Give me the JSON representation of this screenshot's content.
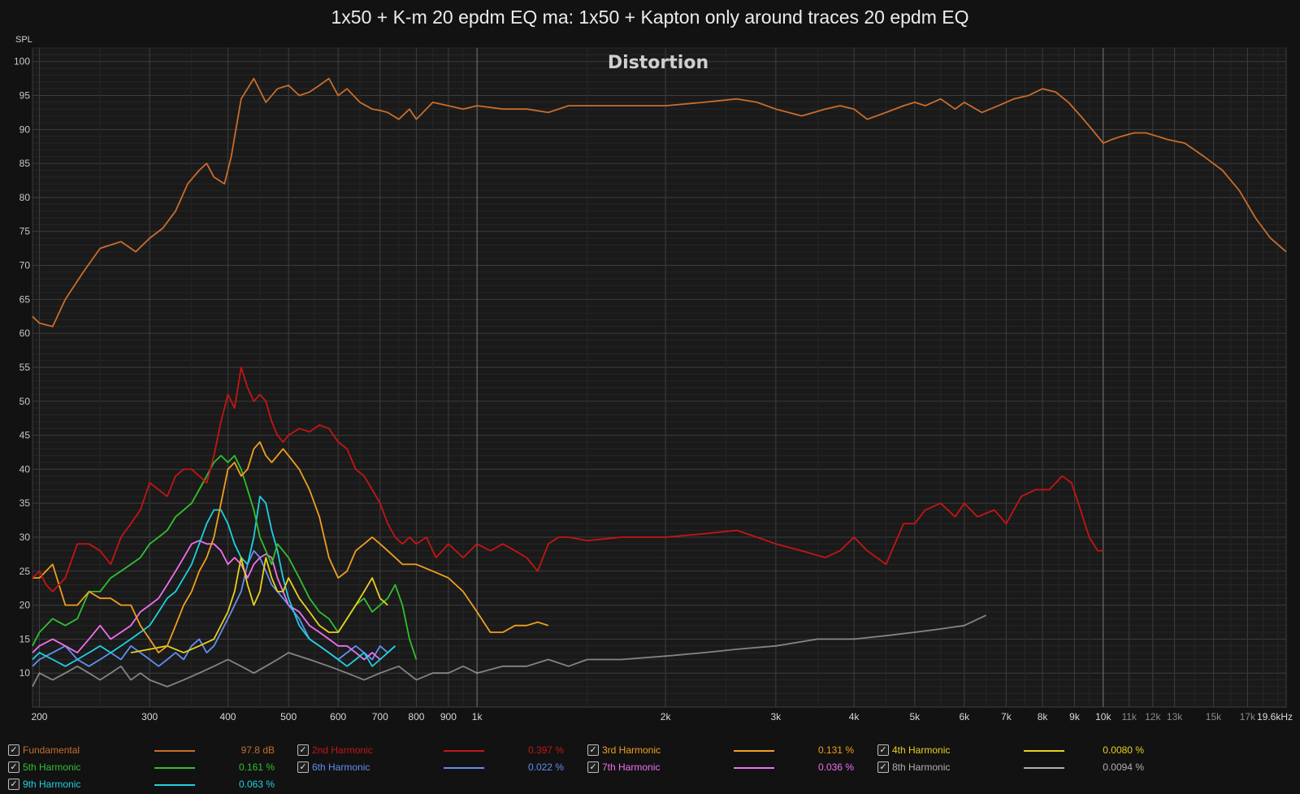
{
  "title": "1x50 + K-m 20 epdm EQ ma: 1x50 + Kapton only around traces 20 epdm EQ",
  "chart_data": {
    "type": "line",
    "title": "Distortion",
    "ylabel": "SPL",
    "x_scale": "log",
    "xlim": [
      195,
      19600
    ],
    "ylim": [
      5,
      102
    ],
    "y_ticks": [
      10,
      15,
      20,
      25,
      30,
      35,
      40,
      45,
      50,
      55,
      60,
      65,
      70,
      75,
      80,
      85,
      90,
      95,
      100
    ],
    "x_ticks": [
      {
        "v": 200,
        "label": "200"
      },
      {
        "v": 300,
        "label": "300"
      },
      {
        "v": 400,
        "label": "400"
      },
      {
        "v": 500,
        "label": "500"
      },
      {
        "v": 600,
        "label": "600"
      },
      {
        "v": 700,
        "label": "700"
      },
      {
        "v": 800,
        "label": "800"
      },
      {
        "v": 900,
        "label": "900"
      },
      {
        "v": 1000,
        "label": "1k"
      },
      {
        "v": 2000,
        "label": "2k"
      },
      {
        "v": 3000,
        "label": "3k"
      },
      {
        "v": 4000,
        "label": "4k"
      },
      {
        "v": 5000,
        "label": "5k"
      },
      {
        "v": 6000,
        "label": "6k"
      },
      {
        "v": 7000,
        "label": "7k"
      },
      {
        "v": 8000,
        "label": "8k"
      },
      {
        "v": 9000,
        "label": "9k"
      },
      {
        "v": 10000,
        "label": "10k"
      },
      {
        "v": 11000,
        "label": "11k"
      },
      {
        "v": 12000,
        "label": "12k"
      },
      {
        "v": 13000,
        "label": "13k"
      },
      {
        "v": 15000,
        "label": "15k"
      },
      {
        "v": 17000,
        "label": "17k"
      },
      {
        "v": 19600,
        "label": "19.6kHz"
      }
    ],
    "series": [
      {
        "name": "Fundamental",
        "color": "#c86d2d",
        "value": "97.8 dB",
        "x": [
          195,
          200,
          210,
          220,
          235,
          250,
          270,
          285,
          300,
          315,
          330,
          345,
          360,
          370,
          380,
          395,
          405,
          420,
          440,
          460,
          480,
          500,
          520,
          540,
          560,
          580,
          600,
          620,
          650,
          680,
          700,
          720,
          750,
          780,
          800,
          850,
          900,
          950,
          1000,
          1100,
          1200,
          1300,
          1400,
          1500,
          1700,
          2000,
          2300,
          2600,
          2800,
          3000,
          3300,
          3600,
          3800,
          4000,
          4200,
          4500,
          4800,
          5000,
          5200,
          5500,
          5800,
          6000,
          6400,
          6800,
          7200,
          7600,
          8000,
          8400,
          8800,
          9200,
          9600,
          10000,
          10300,
          10700,
          11200,
          11700,
          12200,
          12700,
          13500,
          14500,
          15500,
          16500,
          17500,
          18500,
          19600
        ],
        "y": [
          62.5,
          61.5,
          61,
          65,
          69,
          72.5,
          73.5,
          72,
          74,
          75.5,
          78,
          82,
          84,
          85,
          83,
          82,
          86,
          94.5,
          97.5,
          94,
          96,
          96.5,
          95,
          95.5,
          96.5,
          97.5,
          95,
          96,
          94,
          93,
          92.8,
          92.5,
          91.5,
          93,
          91.5,
          94,
          93.5,
          93,
          93.5,
          93,
          93,
          92.5,
          93.5,
          93.5,
          93.5,
          93.5,
          94,
          94.5,
          94,
          93,
          92,
          93,
          93.5,
          93,
          91.5,
          92.5,
          93.5,
          94,
          93.5,
          94.5,
          93,
          94,
          92.5,
          93.5,
          94.5,
          95,
          96,
          95.5,
          94,
          92,
          90,
          88,
          88.5,
          89,
          89.5,
          89.5,
          89,
          88.5,
          88,
          86,
          84,
          81,
          77,
          74,
          72
        ]
      },
      {
        "name": "2nd Harmonic",
        "color": "#c41515",
        "value": "0.397 %",
        "x": [
          195,
          200,
          205,
          210,
          220,
          230,
          240,
          250,
          260,
          270,
          280,
          290,
          300,
          310,
          320,
          330,
          340,
          350,
          360,
          370,
          380,
          390,
          400,
          410,
          420,
          430,
          440,
          450,
          460,
          470,
          480,
          490,
          500,
          520,
          540,
          560,
          580,
          600,
          620,
          640,
          660,
          680,
          700,
          720,
          740,
          760,
          780,
          800,
          830,
          860,
          900,
          950,
          1000,
          1050,
          1100,
          1150,
          1200,
          1250,
          1300,
          1350,
          1400,
          1500,
          1700,
          2000,
          2300,
          2600,
          2800,
          3000,
          3300,
          3600,
          3800,
          4000,
          4200,
          4500,
          4800,
          5000,
          5200,
          5500,
          5800,
          6000,
          6300,
          6700,
          7000,
          7400,
          7800,
          8200,
          8600,
          8900,
          9200,
          9500,
          9800,
          10000
        ],
        "y": [
          24,
          25,
          23,
          22,
          24,
          29,
          29,
          28,
          26,
          30,
          32,
          34,
          38,
          37,
          36,
          39,
          40,
          40,
          39,
          38,
          42,
          47,
          51,
          49,
          55,
          52,
          50,
          51,
          50,
          47,
          45,
          44,
          45,
          46,
          45.5,
          46.5,
          46,
          44,
          43,
          40,
          39,
          37,
          35,
          32,
          30,
          29,
          30,
          29,
          30,
          27,
          29,
          27,
          29,
          28,
          29,
          28,
          27,
          25,
          29,
          30,
          30,
          29.5,
          30,
          30,
          30.5,
          31,
          30,
          29,
          28,
          27,
          28,
          30,
          28,
          26,
          32,
          32,
          34,
          35,
          33,
          35,
          33,
          34,
          32,
          36,
          37,
          37,
          39,
          38,
          34,
          30,
          28,
          28
        ]
      },
      {
        "name": "3rd Harmonic",
        "color": "#f0a020",
        "value": "0.131 %",
        "x": [
          195,
          200,
          210,
          220,
          230,
          240,
          250,
          260,
          270,
          280,
          290,
          300,
          310,
          320,
          330,
          340,
          350,
          360,
          370,
          380,
          390,
          400,
          410,
          420,
          430,
          440,
          450,
          460,
          470,
          480,
          490,
          500,
          520,
          540,
          560,
          580,
          600,
          620,
          640,
          660,
          680,
          700,
          720,
          740,
          760,
          780,
          800,
          850,
          900,
          950,
          1000,
          1050,
          1100,
          1150,
          1200,
          1250,
          1300
        ],
        "y": [
          24,
          24,
          26,
          20,
          20,
          22,
          21,
          21,
          20,
          20,
          17,
          15,
          13,
          14,
          17,
          20,
          22,
          25,
          27,
          30,
          35,
          40,
          41,
          39,
          40,
          43,
          44,
          42,
          41,
          42,
          43,
          42,
          40,
          37,
          33,
          27,
          24,
          25,
          28,
          29,
          30,
          29,
          28,
          27,
          26,
          26,
          26,
          25,
          24,
          22,
          19,
          16,
          16,
          17,
          17,
          17.5,
          17
        ]
      },
      {
        "name": "4th Harmonic",
        "color": "#e8d020",
        "value": "0.0080 %",
        "x": [
          280,
          300,
          320,
          340,
          360,
          380,
          400,
          410,
          420,
          430,
          440,
          450,
          460,
          470,
          480,
          490,
          500,
          520,
          540,
          560,
          580,
          600,
          620,
          640,
          660,
          680,
          700,
          720
        ],
        "y": [
          13,
          13.5,
          14,
          13,
          14,
          15,
          19,
          22,
          27,
          23,
          20,
          22,
          27,
          24,
          22,
          22,
          24,
          21,
          19,
          17,
          16,
          16,
          18,
          20,
          22,
          24,
          21,
          20
        ]
      },
      {
        "name": "5th Harmonic",
        "color": "#30c030",
        "value": "0.161 %",
        "x": [
          195,
          200,
          210,
          220,
          230,
          240,
          250,
          260,
          270,
          280,
          290,
          300,
          310,
          320,
          330,
          340,
          350,
          360,
          370,
          380,
          390,
          400,
          410,
          420,
          430,
          440,
          450,
          460,
          470,
          480,
          490,
          500,
          520,
          540,
          560,
          580,
          600,
          620,
          640,
          660,
          680,
          700,
          720,
          740,
          760,
          780,
          800
        ],
        "y": [
          14,
          16,
          18,
          17,
          18,
          22,
          22,
          24,
          25,
          26,
          27,
          29,
          30,
          31,
          33,
          34,
          35,
          37,
          39,
          41,
          42,
          41,
          42,
          40,
          37,
          34,
          30,
          28,
          26,
          29,
          28,
          27,
          24,
          21,
          19,
          18,
          16,
          18,
          20,
          21,
          19,
          20,
          21,
          23,
          20,
          15,
          12
        ]
      },
      {
        "name": "6th Harmonic",
        "color": "#6090f0",
        "value": "0.022 %",
        "x": [
          195,
          200,
          210,
          220,
          230,
          240,
          250,
          260,
          270,
          280,
          290,
          300,
          310,
          320,
          330,
          340,
          350,
          360,
          370,
          380,
          390,
          400,
          410,
          420,
          430,
          440,
          450,
          460,
          470,
          480,
          490,
          500,
          520,
          540,
          560,
          580,
          600,
          620,
          640,
          660,
          680,
          700,
          720,
          740
        ],
        "y": [
          11,
          12,
          13,
          14,
          12,
          11,
          12,
          13,
          12,
          14,
          13,
          12,
          11,
          12,
          13,
          12,
          14,
          15,
          13,
          14,
          16,
          18,
          20,
          22,
          26,
          28,
          27,
          25,
          23,
          22,
          21,
          20,
          18,
          15,
          14,
          13,
          12,
          13,
          14,
          13,
          12,
          14,
          13,
          14
        ]
      },
      {
        "name": "7th Harmonic",
        "color": "#f070f0",
        "value": "0.036 %",
        "x": [
          195,
          200,
          210,
          220,
          230,
          240,
          250,
          260,
          270,
          280,
          290,
          300,
          310,
          320,
          330,
          340,
          350,
          360,
          370,
          380,
          390,
          400,
          410,
          420,
          430,
          440,
          450,
          460,
          470,
          480,
          490,
          500,
          520,
          540,
          560,
          580,
          600,
          620,
          640,
          660,
          680,
          700
        ],
        "y": [
          13,
          14,
          15,
          14,
          13,
          15,
          17,
          15,
          16,
          17,
          19,
          20,
          21,
          23,
          25,
          27,
          29,
          29.5,
          29,
          29,
          28,
          26,
          27,
          26,
          24,
          26,
          27,
          27.5,
          27,
          24,
          22,
          20,
          19,
          17,
          16,
          15,
          14,
          14,
          13,
          12,
          13,
          12
        ]
      },
      {
        "name": "8th Harmonic",
        "color": "#b0b0b0",
        "value": "0.0094 %",
        "x": [
          195,
          200,
          210,
          220,
          230,
          240,
          250,
          260,
          270,
          280,
          290,
          300,
          320,
          340,
          360,
          380,
          400,
          420,
          440,
          460,
          480,
          500,
          540,
          580,
          620,
          660,
          700,
          750,
          800,
          850,
          900,
          950,
          1000,
          1100,
          1200,
          1300,
          1400,
          1500,
          1700,
          2000,
          2300,
          2600,
          3000,
          3500,
          4000,
          4500,
          5000,
          5500,
          6000,
          6500
        ],
        "y": [
          8,
          10,
          9,
          10,
          11,
          10,
          9,
          10,
          11,
          9,
          10,
          9,
          8,
          9,
          10,
          11,
          12,
          11,
          10,
          11,
          12,
          13,
          12,
          11,
          10,
          9,
          10,
          11,
          9,
          10,
          10,
          11,
          10,
          11,
          11,
          12,
          11,
          12,
          12,
          12.5,
          13,
          13.5,
          14,
          15,
          15,
          15.5,
          16,
          16.5,
          17,
          18.5
        ]
      },
      {
        "name": "9th Harmonic",
        "color": "#20d0e0",
        "value": "0.063 %",
        "x": [
          195,
          200,
          210,
          220,
          230,
          240,
          250,
          260,
          270,
          280,
          290,
          300,
          310,
          320,
          330,
          340,
          350,
          360,
          370,
          380,
          390,
          400,
          410,
          420,
          430,
          440,
          450,
          460,
          470,
          480,
          490,
          500,
          520,
          540,
          560,
          580,
          600,
          620,
          640,
          660,
          680,
          700,
          720,
          740
        ],
        "y": [
          12,
          13,
          12,
          11,
          12,
          13,
          14,
          13,
          14,
          15,
          16,
          17,
          19,
          21,
          22,
          24,
          26,
          29,
          32,
          34,
          34,
          32,
          29,
          27,
          26,
          30,
          36,
          35,
          31,
          28,
          24,
          21,
          17,
          15,
          14,
          13,
          12,
          11,
          12,
          13,
          11,
          12,
          13,
          14
        ]
      }
    ]
  },
  "legend": [
    {
      "label": "Fundamental",
      "value": "97.8 dB",
      "color": "#c86d2d",
      "checked": "✓"
    },
    {
      "label": "2nd Harmonic",
      "value": "0.397 %",
      "color": "#c41515",
      "checked": "✓"
    },
    {
      "label": "3rd Harmonic",
      "value": "0.131 %",
      "color": "#f0a020",
      "checked": "✓"
    },
    {
      "label": "4th Harmonic",
      "value": "0.0080 %",
      "color": "#e8d020",
      "checked": "✓"
    },
    {
      "label": "5th Harmonic",
      "value": "0.161 %",
      "color": "#30c030",
      "checked": "✓"
    },
    {
      "label": "6th Harmonic",
      "value": "0.022 %",
      "color": "#6090f0",
      "checked": "✓"
    },
    {
      "label": "7th Harmonic",
      "value": "0.036 %",
      "color": "#f070f0",
      "checked": "✓"
    },
    {
      "label": "8th Harmonic",
      "value": "0.0094 %",
      "color": "#b0b0b0",
      "checked": "✓"
    },
    {
      "label": "9th Harmonic",
      "value": "0.063 %",
      "color": "#20d0e0",
      "checked": "✓"
    }
  ]
}
